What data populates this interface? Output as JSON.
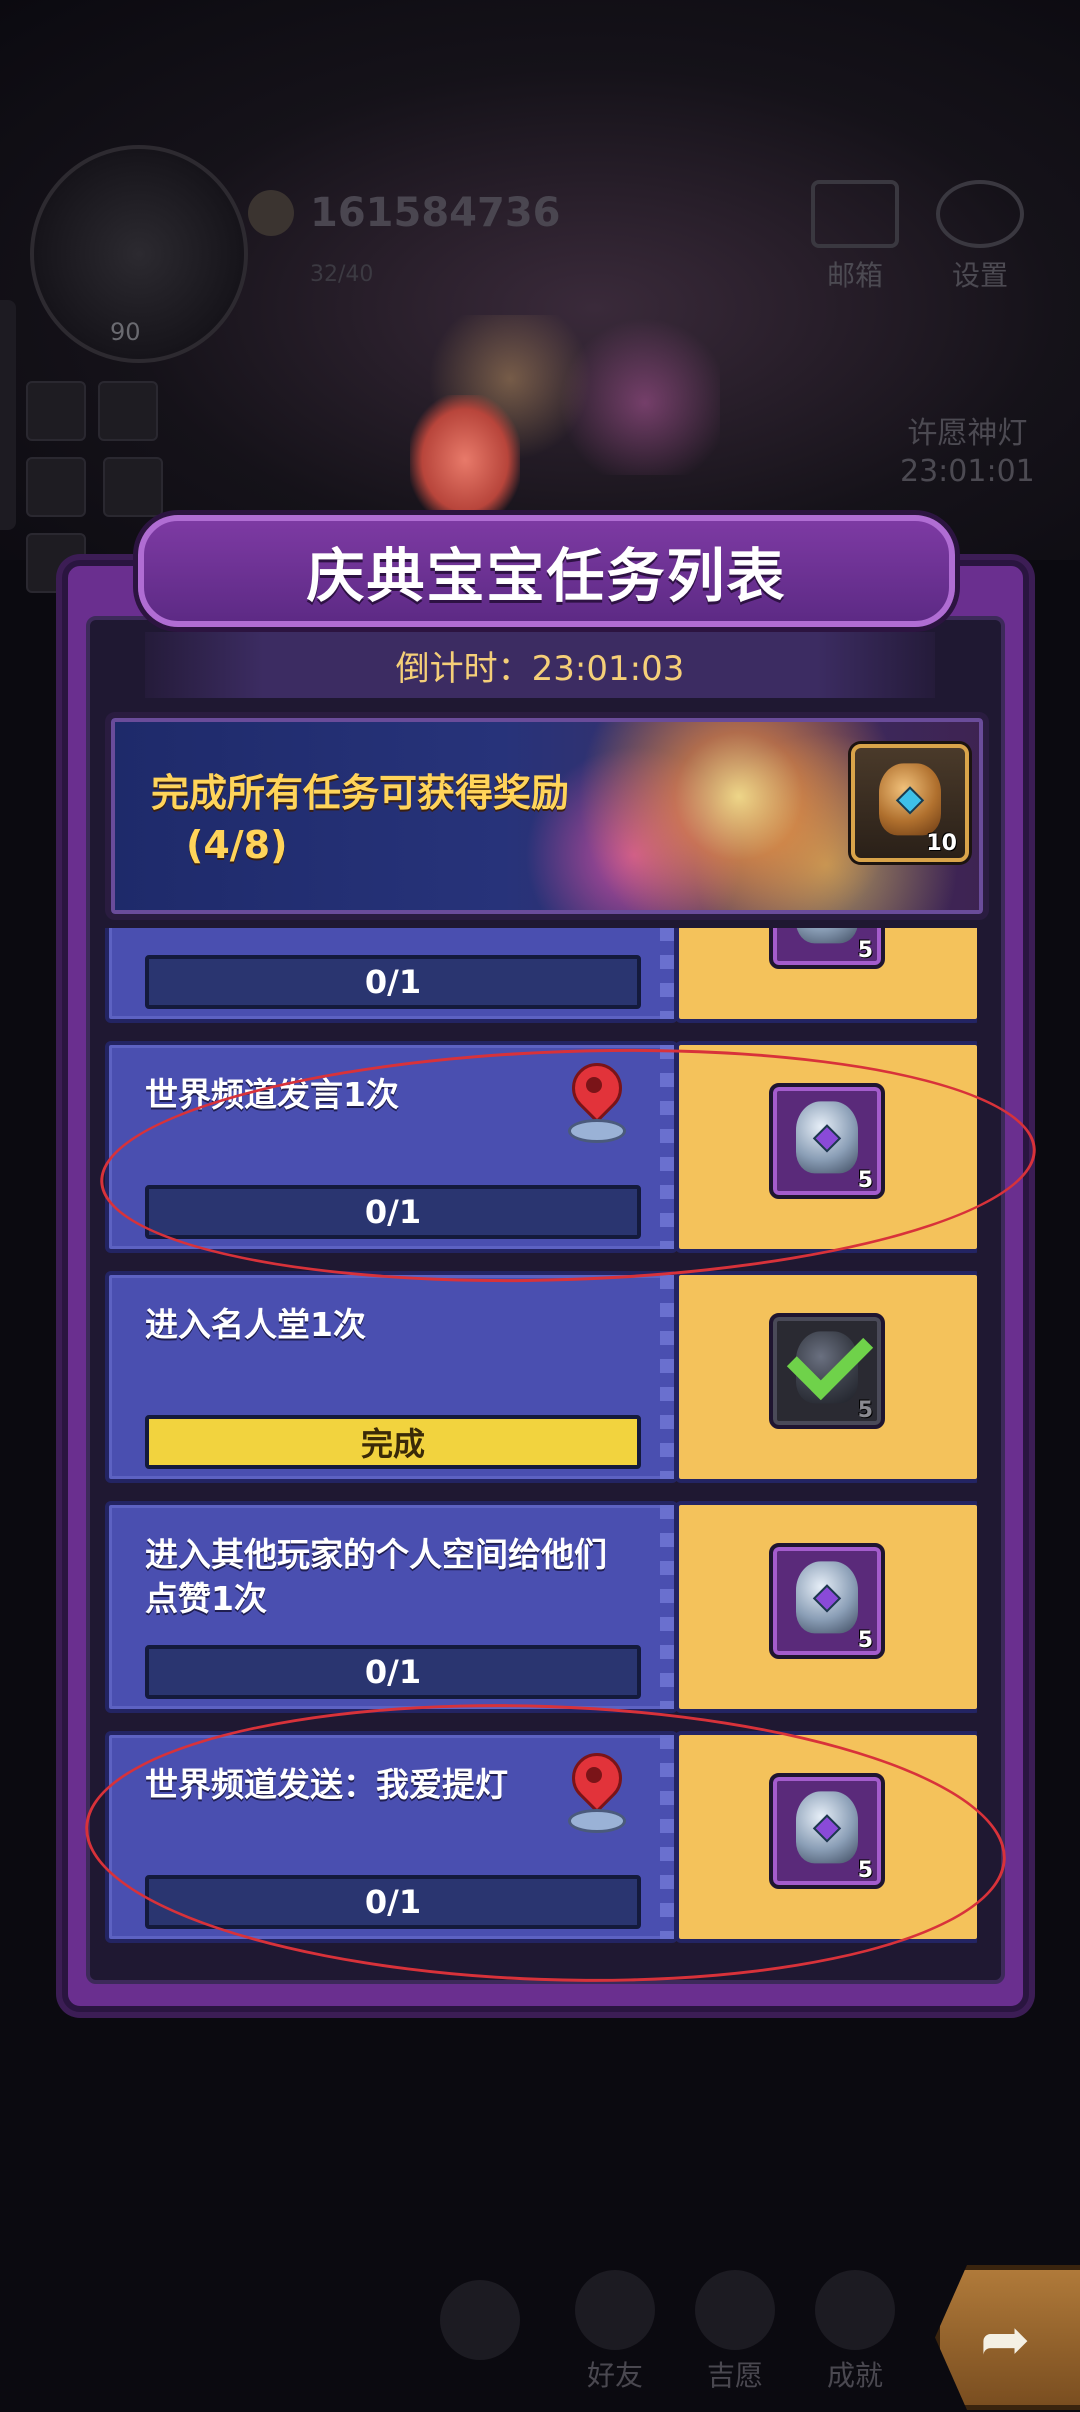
{
  "hud": {
    "avatar_level": "90",
    "coins": "161584736",
    "coins_sub": "32/40",
    "mail_label": "邮箱",
    "settings_label": "设置",
    "wish_lamp_label": "许愿神灯",
    "wish_lamp_timer": "23:01:01"
  },
  "dialog": {
    "title": "庆典宝宝任务列表",
    "countdown": "倒计时：23:01:03",
    "all_tasks_reward": {
      "text": "完成所有任务可获得奖励",
      "progress": "(4/8)",
      "item_qty": "10",
      "item_icon": "gold-jar-icon"
    },
    "tasks": [
      {
        "title": "",
        "progress": "0/1",
        "done": false,
        "has_location": false,
        "reward_qty": "5",
        "claimed": false
      },
      {
        "title": "世界频道发言1次",
        "progress": "0/1",
        "done": false,
        "has_location": true,
        "reward_qty": "5",
        "claimed": false
      },
      {
        "title": "进入名人堂1次",
        "progress": "完成",
        "done": true,
        "has_location": false,
        "reward_qty": "5",
        "claimed": true
      },
      {
        "title": "进入其他玩家的个人空间给他们点赞1次",
        "progress": "0/1",
        "done": false,
        "has_location": false,
        "reward_qty": "5",
        "claimed": false
      },
      {
        "title": "世界频道发送：我爱提灯",
        "progress": "0/1",
        "done": false,
        "has_location": true,
        "reward_qty": "5",
        "claimed": false
      }
    ]
  },
  "bottom_nav": {
    "friends_label": "好友",
    "wishes_label": "吉愿",
    "achievements_label": "成就"
  },
  "colors": {
    "dialog_purple": "#6a2f8f",
    "task_blue": "#4a4fb0",
    "reward_yellow": "#f4c25b",
    "done_bar_yellow": "#f2d33e",
    "countdown_gold": "#f5cf78",
    "annotation_red": "#d8323a"
  }
}
